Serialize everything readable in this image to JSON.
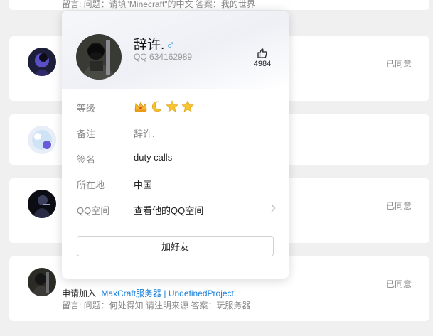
{
  "list": {
    "top_note": "留言: 问题：请填\"Minecraft\"的中文 答案：我的世界",
    "rows": [
      {
        "status": "已同意"
      },
      {
        "status": ""
      },
      {
        "status": "已同意"
      },
      {
        "status": "已同意",
        "apply_prefix": "申请加入",
        "group_name": "MaxCraft服务器 | UndefinedProject",
        "note": "留言: 问题：何处得知 请注明来源 答案：玩服务器"
      }
    ]
  },
  "popup": {
    "nickname": "辞许.",
    "gender_symbol": "♂",
    "qq_label": "QQ",
    "qq_number": "634162989",
    "likes": "4984",
    "rows": {
      "level": {
        "label": "等级",
        "badges": [
          "crown-icon",
          "moon-icon",
          "star-icon",
          "star-icon"
        ]
      },
      "remark": {
        "label": "备注",
        "value": "辞许."
      },
      "signature": {
        "label": "签名",
        "value": "duty calls"
      },
      "location": {
        "label": "所在地",
        "value": "中国"
      },
      "qzone": {
        "label": "QQ空间",
        "value": "查看他的QQ空间"
      }
    },
    "add_friend_label": "加好友"
  },
  "colors": {
    "background": "#f0f0f0",
    "card": "#ffffff",
    "link": "#1a7fd9",
    "muted": "#888888",
    "gender": "#3aa0e6",
    "badge_gold": "#f5b92a"
  }
}
